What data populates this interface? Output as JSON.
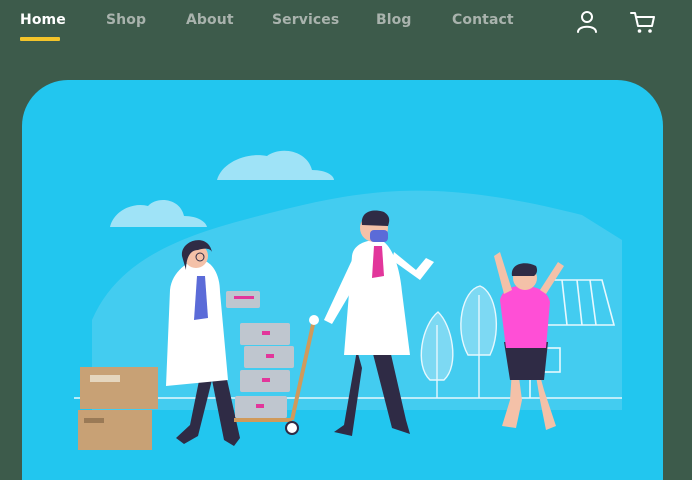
{
  "nav": {
    "items": [
      {
        "label": "Home",
        "active": true
      },
      {
        "label": "Shop",
        "active": false
      },
      {
        "label": "About",
        "active": false
      },
      {
        "label": "Services",
        "active": false
      },
      {
        "label": "Blog",
        "active": false
      },
      {
        "label": "Contact",
        "active": false
      }
    ],
    "icons": [
      "user-icon",
      "cart-icon"
    ]
  },
  "colors": {
    "background": "#3d5b4b",
    "hero": "#22c6ef",
    "active_underline": "#f3c42a",
    "nav_text": "#a9b3ad",
    "nav_active_text": "#ffffff"
  },
  "hero": {
    "illustration": "doctors-delivering-medical-supplies"
  }
}
